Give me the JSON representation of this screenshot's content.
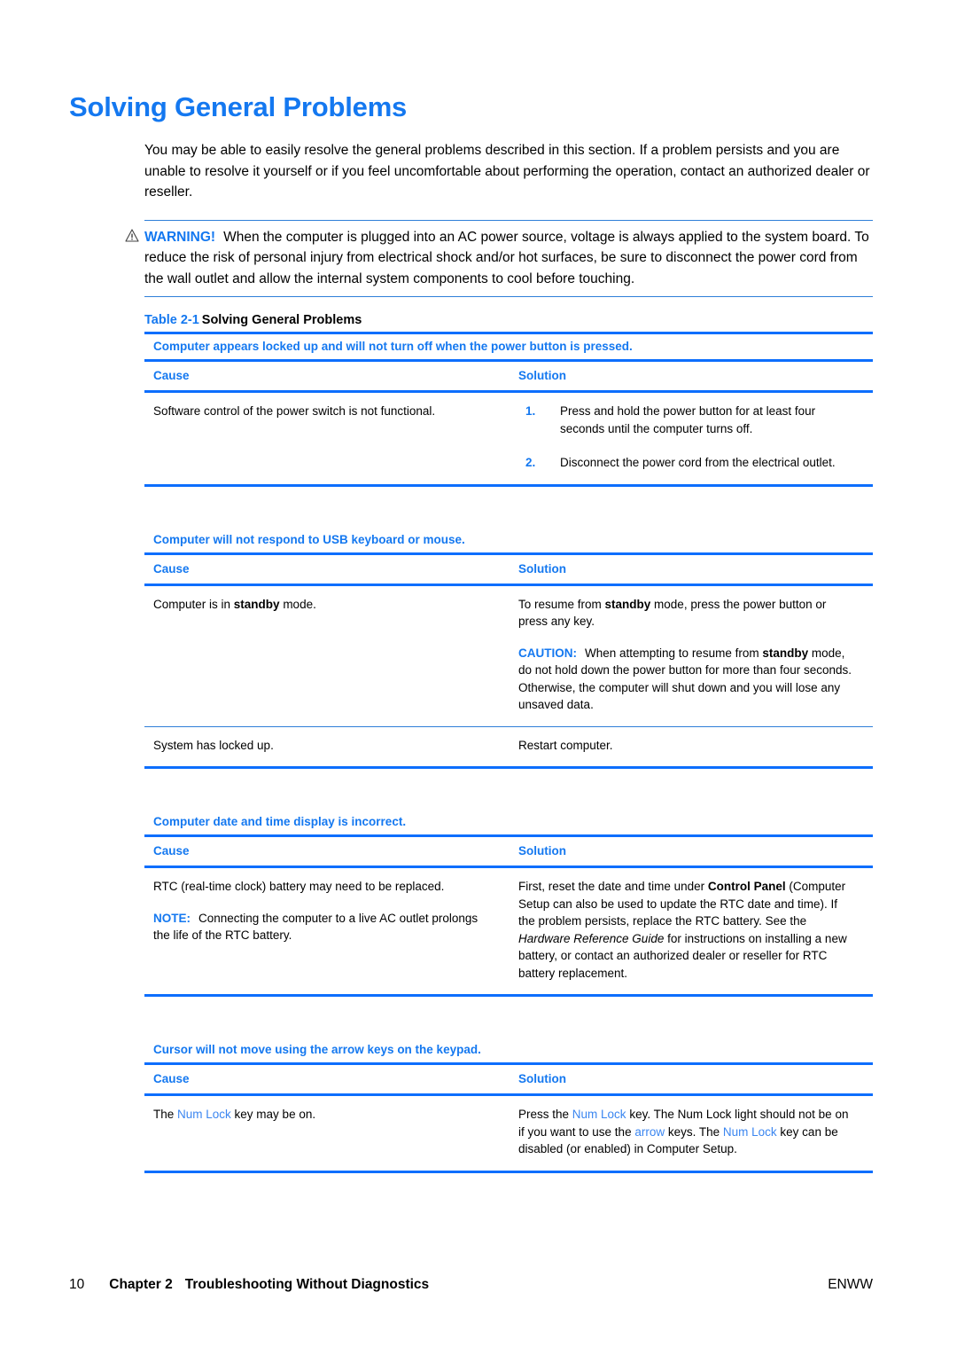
{
  "page_title": "Solving General Problems",
  "intro": "You may be able to easily resolve the general problems described in this section. If a problem persists and you are unable to resolve it yourself or if you feel uncomfortable about performing the operation, contact an authorized dealer or reseller.",
  "warning": {
    "icon": "warning-triangle-icon",
    "label": "WARNING!",
    "text": "When the computer is plugged into an AC power source, voltage is always applied to the system board. To reduce the risk of personal injury from electrical shock and/or hot surfaces, be sure to disconnect the power cord from the wall outlet and allow the internal system components to cool before touching."
  },
  "table_caption": {
    "number": "Table 2-1",
    "title": "Solving General Problems"
  },
  "columns": {
    "cause": "Cause",
    "solution": "Solution"
  },
  "sections": [
    {
      "heading": "Computer appears locked up and will not turn off when the power button is pressed.",
      "rows": [
        {
          "cause": "Software control of the power switch is not functional.",
          "solution_steps": [
            {
              "n": "1.",
              "text": "Press and hold the power button for at least four seconds until the computer turns off."
            },
            {
              "n": "2.",
              "text": "Disconnect the power cord from the electrical outlet."
            }
          ]
        }
      ]
    },
    {
      "heading": "Computer will not respond to USB keyboard or mouse.",
      "rows": [
        {
          "cause_prefix": "Computer is in ",
          "cause_bold": "standby",
          "cause_suffix": " mode.",
          "solution_p1_a": "To resume from ",
          "solution_p1_bold": "standby",
          "solution_p1_b": " mode, press the power button or press any key.",
          "caution_label": "CAUTION:",
          "caution_a": "When attempting to resume from ",
          "caution_bold": "standby",
          "caution_b": " mode, do not hold down the power button for more than four seconds. Otherwise, the computer will shut down and you will lose any unsaved data."
        },
        {
          "cause": "System has locked up.",
          "solution": "Restart computer."
        }
      ]
    },
    {
      "heading": "Computer date and time display is incorrect.",
      "rows": [
        {
          "cause": "RTC (real-time clock) battery may need to be replaced.",
          "note_label": "NOTE:",
          "note_text": "Connecting the computer to a live AC outlet prolongs the life of the RTC battery.",
          "solution_a": "First, reset the date and time under ",
          "solution_bold": "Control Panel",
          "solution_b": " (Computer Setup can also be used to update the RTC date and time). If the problem persists, replace the RTC battery. See the ",
          "solution_italic": "Hardware Reference Guide",
          "solution_c": " for instructions on installing a new battery, or contact an authorized dealer or reseller for RTC battery replacement."
        }
      ]
    },
    {
      "heading": "Cursor will not move using the arrow keys on the keypad.",
      "rows": [
        {
          "cause_a": "The ",
          "cause_link": "Num Lock",
          "cause_b": " key may be on.",
          "solution_a": "Press the ",
          "solution_link1": "Num Lock",
          "solution_b": " key. The Num Lock light should not be on if you want to use the ",
          "solution_link2": "arrow",
          "solution_c": " keys. The ",
          "solution_link3": "Num Lock",
          "solution_d": " key can be disabled (or enabled) in Computer Setup."
        }
      ]
    }
  ],
  "footer": {
    "page_number": "10",
    "chapter": "Chapter 2",
    "title": "Troubleshooting Without Diagnostics",
    "edition": "ENWW"
  }
}
